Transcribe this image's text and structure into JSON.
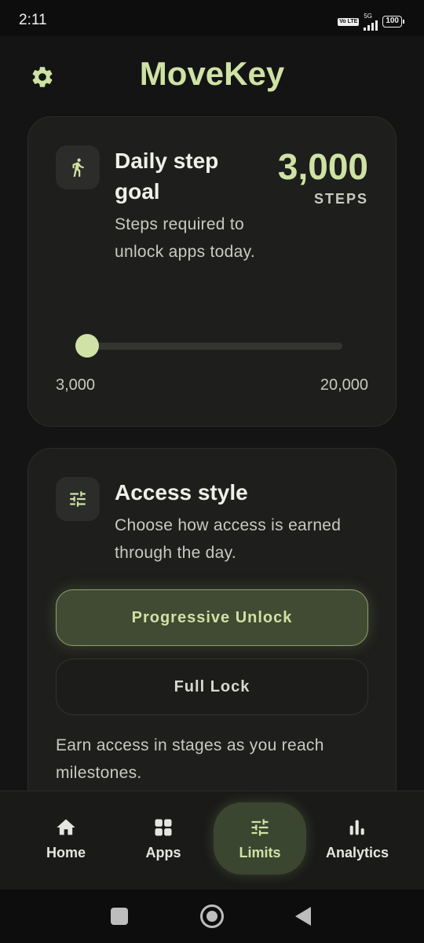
{
  "status_bar": {
    "time": "2:11",
    "volte": "Vo LTE",
    "network": "5G",
    "battery": "100"
  },
  "header": {
    "title": "MoveKey",
    "settings_icon": "gear-icon"
  },
  "step_goal": {
    "icon": "walking-person-icon",
    "title": "Daily step goal",
    "description": "Steps required to unlock apps today.",
    "value": "3,000",
    "unit": "STEPS",
    "slider": {
      "min": 3000,
      "max": 20000,
      "current": 3000,
      "min_label": "3,000",
      "max_label": "20,000"
    }
  },
  "access_style": {
    "icon": "sliders-icon",
    "title": "Access style",
    "description": "Choose how access is earned through the day.",
    "options": [
      {
        "label": "Progressive Unlock",
        "selected": true
      },
      {
        "label": "Full Lock",
        "selected": false
      }
    ],
    "note": "Earn access in stages as you reach milestones."
  },
  "bottom_nav": {
    "items": [
      {
        "label": "Home",
        "icon": "home-icon",
        "active": false
      },
      {
        "label": "Apps",
        "icon": "grid-icon",
        "active": false
      },
      {
        "label": "Limits",
        "icon": "sliders-icon",
        "active": true
      },
      {
        "label": "Analytics",
        "icon": "bar-chart-icon",
        "active": false
      }
    ]
  },
  "colors": {
    "accent": "#cfe2a4",
    "background": "#141414",
    "card": "#1e1e1c",
    "active_button": "#414a33"
  }
}
